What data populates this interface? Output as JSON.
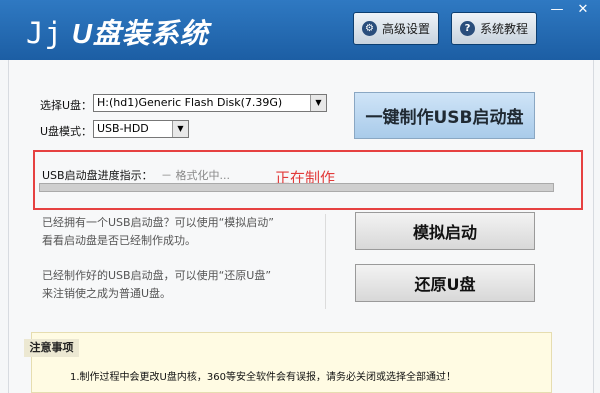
{
  "app": {
    "title_prefix": "Jj",
    "title": "U盘装系统"
  },
  "header": {
    "settings_label": "高级设置",
    "tutorial_label": "系统教程",
    "minimize": "—",
    "close": "✕"
  },
  "form": {
    "usb_select_label": "选择U盘：",
    "usb_select_value": "H:(hd1)Generic Flash Disk(7.39G)",
    "mode_label": "U盘模式：",
    "mode_value": "USB-HDD",
    "make_button_label": "一键制作USB启动盘"
  },
  "progress": {
    "label": "USB启动盘进度指示：",
    "stage": "－ 格式化中...",
    "status": "正在制作",
    "fraction": 0.0
  },
  "simulate": {
    "line1": "已经拥有一个USB启动盘？可以使用“模拟启动”",
    "line2": "看看启动盘是否已经制作成功。",
    "button_label": "模拟启动"
  },
  "restore": {
    "line1": "已经制作好的USB启动盘，可以使用“还原U盘”",
    "line2": "来注销使之成为普通U盘。",
    "button_label": "还原U盘"
  },
  "notice": {
    "title": "注意事项",
    "item1": "1.制作过程中会更改U盘内核，360等安全软件会有误报，请务必关闭或选择全部通过！"
  }
}
